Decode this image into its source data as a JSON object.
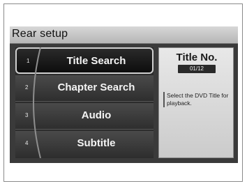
{
  "header": {
    "title": "Rear setup"
  },
  "menu": {
    "items": [
      {
        "number": "1",
        "label": "Title Search",
        "selected": true
      },
      {
        "number": "2",
        "label": "Chapter Search",
        "selected": false
      },
      {
        "number": "3",
        "label": "Audio",
        "selected": false
      },
      {
        "number": "4",
        "label": "Subtitle",
        "selected": false
      }
    ]
  },
  "info": {
    "heading": "Title No.",
    "value": "01/12",
    "description": "Select the DVD Title for playback."
  }
}
